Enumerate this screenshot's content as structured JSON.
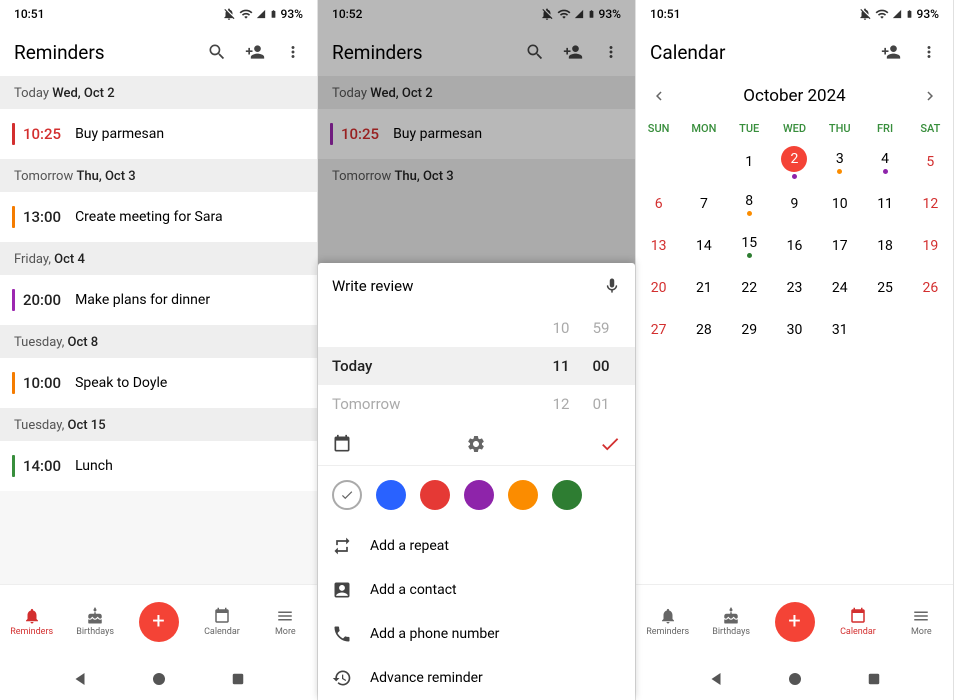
{
  "status": {
    "time1": "10:51",
    "time2": "10:52",
    "time3": "10:51",
    "battery": "93%"
  },
  "screen1": {
    "title": "Reminders",
    "sections": [
      {
        "label_pre": "Today ",
        "label_bold": "Wed, Oct 2",
        "items": [
          {
            "time": "10:25",
            "text": "Buy parmesan",
            "color": "red",
            "time_red": true
          }
        ]
      },
      {
        "label_pre": "Tomorrow ",
        "label_bold": "Thu, Oct 3",
        "items": [
          {
            "time": "13:00",
            "text": "Create meeting for Sara",
            "color": "orange",
            "time_red": false
          }
        ]
      },
      {
        "label_pre": "Friday, ",
        "label_bold": "Oct 4",
        "items": [
          {
            "time": "20:00",
            "text": "Make plans for dinner",
            "color": "purple",
            "time_red": false
          }
        ]
      },
      {
        "label_pre": "Tuesday, ",
        "label_bold": "Oct 8",
        "items": [
          {
            "time": "10:00",
            "text": "Speak to Doyle",
            "color": "orange",
            "time_red": false
          }
        ]
      },
      {
        "label_pre": "Tuesday, ",
        "label_bold": "Oct 15",
        "items": [
          {
            "time": "14:00",
            "text": "Lunch",
            "color": "green",
            "time_red": false
          }
        ]
      }
    ]
  },
  "screen2": {
    "title": "Reminders",
    "bg_section": {
      "label_pre": "Today ",
      "label_bold": "Wed, Oct 2",
      "time": "10:25",
      "text": "Buy parmesan"
    },
    "bg_section2": {
      "label_pre": "Tomorrow ",
      "label_bold": "Thu, Oct 3"
    },
    "sheet": {
      "input_text": "Write review",
      "picker": [
        {
          "label": "",
          "h": "10",
          "m": "59"
        },
        {
          "label": "Today",
          "h": "11",
          "m": "00",
          "selected": true
        },
        {
          "label": "Tomorrow",
          "h": "12",
          "m": "01"
        }
      ],
      "colors": [
        "#2962ff",
        "#e53935",
        "#8e24aa",
        "#fb8c00",
        "#2e7d32"
      ],
      "options": [
        {
          "icon": "repeat",
          "label": "Add a repeat"
        },
        {
          "icon": "contact",
          "label": "Add a contact"
        },
        {
          "icon": "phone",
          "label": "Add a phone number"
        },
        {
          "icon": "history",
          "label": "Advance reminder"
        }
      ]
    }
  },
  "screen3": {
    "title": "Calendar",
    "month": "October 2024",
    "dow": [
      "SUN",
      "MON",
      "TUE",
      "WED",
      "THU",
      "FRI",
      "SAT"
    ],
    "cells": [
      null,
      null,
      {
        "n": "1"
      },
      {
        "n": "2",
        "today": true,
        "dot": "#8e24aa"
      },
      {
        "n": "3",
        "dot": "#fb8c00"
      },
      {
        "n": "4",
        "dot": "#8e24aa"
      },
      {
        "n": "5",
        "we": true
      },
      {
        "n": "6",
        "we": true
      },
      {
        "n": "7"
      },
      {
        "n": "8",
        "dot": "#fb8c00"
      },
      {
        "n": "9"
      },
      {
        "n": "10"
      },
      {
        "n": "11"
      },
      {
        "n": "12",
        "we": true
      },
      {
        "n": "13",
        "we": true
      },
      {
        "n": "14"
      },
      {
        "n": "15",
        "dot": "#2e7d32"
      },
      {
        "n": "16"
      },
      {
        "n": "17"
      },
      {
        "n": "18"
      },
      {
        "n": "19",
        "we": true
      },
      {
        "n": "20",
        "we": true
      },
      {
        "n": "21"
      },
      {
        "n": "22"
      },
      {
        "n": "23"
      },
      {
        "n": "24"
      },
      {
        "n": "25"
      },
      {
        "n": "26",
        "we": true
      },
      {
        "n": "27",
        "we": true
      },
      {
        "n": "28"
      },
      {
        "n": "29"
      },
      {
        "n": "30"
      },
      {
        "n": "31"
      },
      null,
      null
    ]
  },
  "nav": {
    "reminders": "Reminders",
    "birthdays": "Birthdays",
    "calendar": "Calendar",
    "more": "More"
  }
}
